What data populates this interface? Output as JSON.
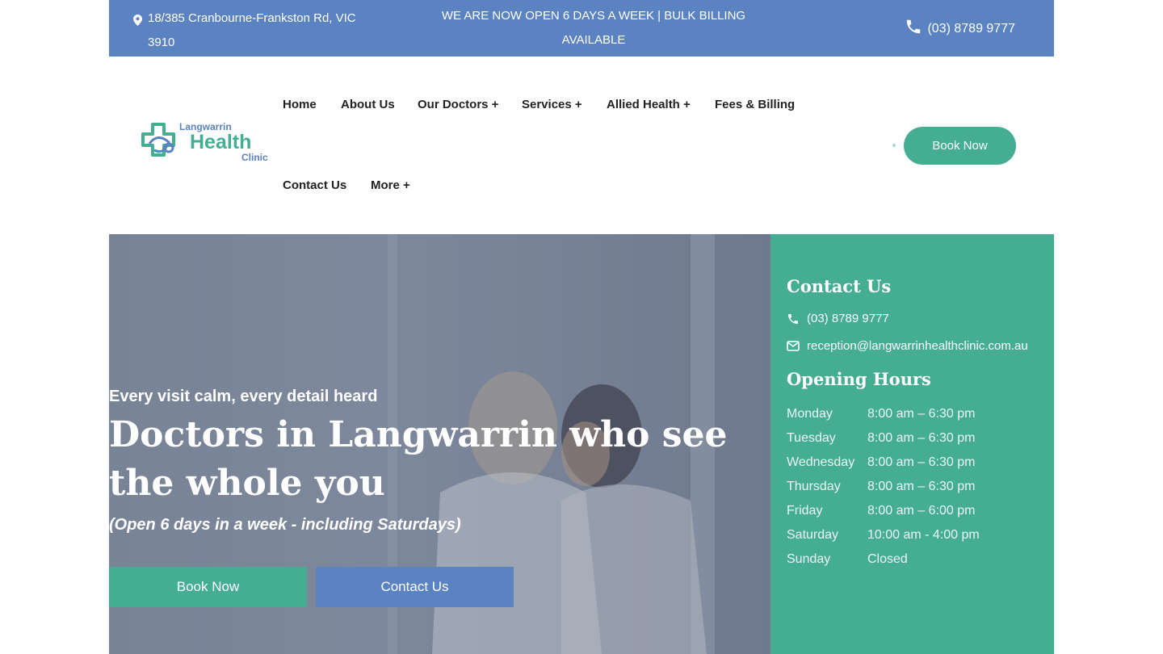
{
  "topbar": {
    "address": "18/385 Cranbourne-Frankston Rd, VIC 3910",
    "promo": "WE ARE NOW OPEN 6 DAYS A WEEK | BULK BILLING AVAILABLE",
    "phone": "(03) 8789 9777"
  },
  "logo": {
    "line1": "Langwarrin",
    "line2": "Health",
    "line3": "Clinic"
  },
  "nav": {
    "home": "Home",
    "about": "About Us",
    "doctors": "Our Doctors +",
    "services": "Services +",
    "allied": "Allied Health +",
    "fees": "Fees & Billing",
    "contact": "Contact Us",
    "more": "More +"
  },
  "header": {
    "book_label": "Book Now"
  },
  "hero": {
    "kicker": "Every visit calm, every detail heard",
    "headline": "Doctors in Langwarrin who see the whole you",
    "sub": "(Open 6 days in a week - including Saturdays)",
    "book_label": "Book Now",
    "contact_label": "Contact Us"
  },
  "contact_panel": {
    "title": "Contact Us",
    "phone": "(03) 8789 9777",
    "email": "reception@langwarrinhealthclinic.com.au",
    "hours_title": "Opening Hours",
    "hours": [
      {
        "day": "Monday",
        "time": "8:00 am – 6:30 pm"
      },
      {
        "day": "Tuesday",
        "time": "8:00 am – 6:30 pm"
      },
      {
        "day": "Wednesday",
        "time": "8:00 am – 6:30 pm"
      },
      {
        "day": "Thursday",
        "time": "8:00 am – 6:30 pm"
      },
      {
        "day": "Friday",
        "time": "8:00 am – 6:00 pm"
      },
      {
        "day": "Saturday",
        "time": "10:00 am - 4:00 pm"
      },
      {
        "day": "Sunday",
        "time": "Closed"
      }
    ]
  },
  "colors": {
    "brand_blue": "#5b82c1",
    "brand_green": "#44ad92"
  }
}
